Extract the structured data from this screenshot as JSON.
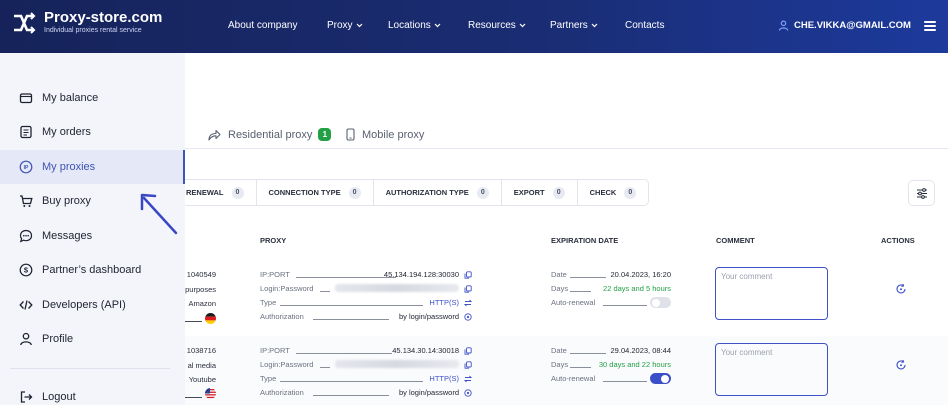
{
  "brand": {
    "title": "Proxy-store.com",
    "subtitle": "Individual proxies rental service"
  },
  "nav": [
    {
      "label": "About company",
      "dropdown": false
    },
    {
      "label": "Proxy",
      "dropdown": true
    },
    {
      "label": "Locations",
      "dropdown": true
    },
    {
      "label": "Resources",
      "dropdown": true
    },
    {
      "label": "Partners",
      "dropdown": true
    },
    {
      "label": "Contacts",
      "dropdown": false
    }
  ],
  "user": {
    "email": "CHE.VIKKA@GMAIL.COM"
  },
  "sidebar": {
    "items": [
      {
        "label": "My balance",
        "icon": "wallet-icon"
      },
      {
        "label": "My orders",
        "icon": "orders-icon"
      },
      {
        "label": "My proxies",
        "icon": "ip-icon",
        "active": true
      },
      {
        "label": "Buy proxy",
        "icon": "cart-icon"
      },
      {
        "label": "Messages",
        "icon": "chat-icon"
      },
      {
        "label": "Partner’s dashboard",
        "icon": "dollar-icon"
      },
      {
        "label": "Developers (API)",
        "icon": "code-icon"
      },
      {
        "label": "Profile",
        "icon": "user-icon"
      }
    ],
    "logout": "Logout"
  },
  "tabs": [
    {
      "label": "Residential proxy",
      "badge": "1"
    },
    {
      "label": "Mobile proxy"
    }
  ],
  "filters": [
    {
      "label": "RENEWAL",
      "count": "0"
    },
    {
      "label": "CONNECTION TYPE",
      "count": "0"
    },
    {
      "label": "AUTHORIZATION TYPE",
      "count": "0"
    },
    {
      "label": "EXPORT",
      "count": "0"
    },
    {
      "label": "CHECK",
      "count": "0"
    }
  ],
  "table": {
    "headers": {
      "proxy": "PROXY",
      "expiration": "EXPIRATION DATE",
      "comment": "COMMENT",
      "actions": "ACTIONS"
    },
    "labels": {
      "ipport": "IP:PORT",
      "login": "Login:Password",
      "type": "Type",
      "auth": "Authorization",
      "date": "Date",
      "days": "Days",
      "renewal": "Auto-renewal"
    },
    "comment_placeholder": "Your comment",
    "rows": [
      {
        "id": "1040549",
        "purpose": "purposes",
        "site": "Amazon",
        "flag": "de",
        "ipport": "45.134.194.128:30030",
        "type": "HTTP(S)",
        "auth": "by login/password",
        "date": "20.04.2023, 16:20",
        "days": "22 days and 5 hours",
        "renewal": false
      },
      {
        "id": "1038716",
        "purpose": "al media",
        "site": "Youtube",
        "flag": "us",
        "ipport": "45.134.30.14:30018",
        "type": "HTTP(S)",
        "auth": "by login/password",
        "date": "29.04.2023, 08:44",
        "days": "30 days and 22 hours",
        "renewal": true
      }
    ]
  },
  "colors": {
    "accent": "#3f52c6",
    "green": "#23a046",
    "header": "#16235a"
  }
}
